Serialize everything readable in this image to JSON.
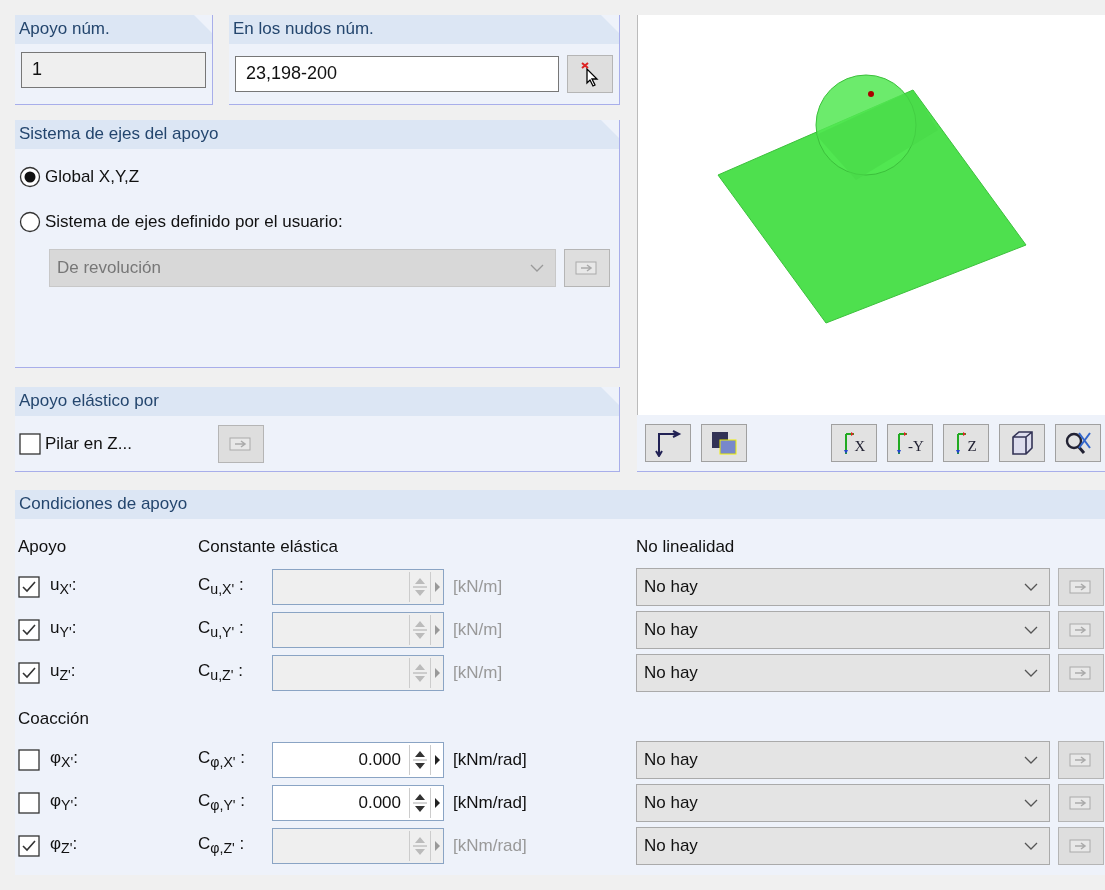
{
  "support_no": {
    "label": "Apoyo núm.",
    "value": "1"
  },
  "nodes": {
    "label": "En los nudos núm.",
    "value": "23,198-200"
  },
  "axis_system": {
    "title": "Sistema de ejes del apoyo",
    "options": [
      {
        "label": "Global X,Y,Z",
        "selected": true
      },
      {
        "label": "Sistema de ejes definido por el usuario:",
        "selected": false
      }
    ],
    "dropdown": {
      "value": "De revolución",
      "disabled": true
    }
  },
  "elastic": {
    "title": "Apoyo elástico por",
    "checkbox": {
      "label": "Pilar en Z...",
      "checked": false
    }
  },
  "left_tools": [
    {
      "kind": "axes"
    },
    {
      "kind": "render"
    }
  ],
  "right_tools": [
    {
      "kind": "view",
      "label": "X"
    },
    {
      "kind": "view",
      "label": "-Y"
    },
    {
      "kind": "view",
      "label": "Z"
    },
    {
      "kind": "iso"
    },
    {
      "kind": "zoom"
    }
  ],
  "conditions": {
    "title": "Condiciones de apoyo",
    "columns": [
      "Apoyo",
      "Constante elástica",
      "No linealidad"
    ],
    "translations": [
      {
        "label": "u$_{X'}$:",
        "checked": true,
        "constant": "C$_{u,X'}$ :",
        "unit": "[kN/m]",
        "nonlinearity": "No hay"
      },
      {
        "label": "u$_{Y'}$:",
        "checked": true,
        "constant": "C$_{u,Y'}$ :",
        "unit": "[kN/m]",
        "nonlinearity": "No hay"
      },
      {
        "label": "u$_{Z'}$:",
        "checked": true,
        "constant": "C$_{u,Z'}$ :",
        "unit": "[kN/m]",
        "nonlinearity": "No hay"
      }
    ],
    "rotations_title": "Coacción",
    "rotations": [
      {
        "label": "φ$_{X'}$:",
        "checked": false,
        "constant": "C$_{φ,X'}$ :",
        "value": "0.000",
        "unit": "[kNm/rad]",
        "nonlinearity": "No hay"
      },
      {
        "label": "φ$_{Y'}$:",
        "checked": false,
        "constant": "C$_{φ,Y'}$ :",
        "value": "0.000",
        "unit": "[kNm/rad]",
        "nonlinearity": "No hay"
      },
      {
        "label": "φ$_{Z'}$:",
        "checked": true,
        "constant": "C$_{φ,Z'}$ :",
        "unit": "[kNm/rad]",
        "nonlinearity": "No hay"
      }
    ]
  }
}
